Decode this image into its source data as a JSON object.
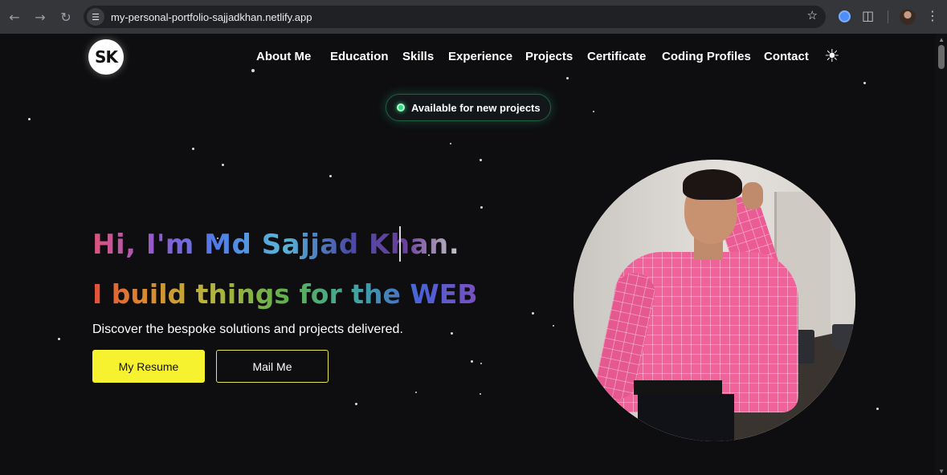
{
  "browser": {
    "url": "my-personal-portfolio-sajjadkhan.netlify.app",
    "icons": [
      "back-arrow-icon",
      "forward-arrow-icon",
      "reload-icon",
      "site-info-icon",
      "bookmark-star-icon",
      "extension-icon",
      "puzzle-icon",
      "profile-avatar",
      "kebab-menu-icon"
    ]
  },
  "site": {
    "logo_text": "SK",
    "nav": [
      "About Me",
      "Education",
      "Skills",
      "Experience",
      "Projects",
      "Certificate",
      "Coding Profiles",
      "Contact"
    ],
    "theme_toggle_icon": "sun-icon"
  },
  "hero": {
    "badge_text": "Available for new projects",
    "badge_color": "#2ee07a",
    "headline": "Hi, I'm Md Sajjad Khan.",
    "subheadline": "I build things for the WEB",
    "tagline": "Discover the bespoke solutions and projects delivered.",
    "resume_button": "My Resume",
    "mail_button": "Mail Me",
    "accent_color": "#f7f230"
  },
  "portrait": {
    "description_icon": "profile-photo"
  }
}
